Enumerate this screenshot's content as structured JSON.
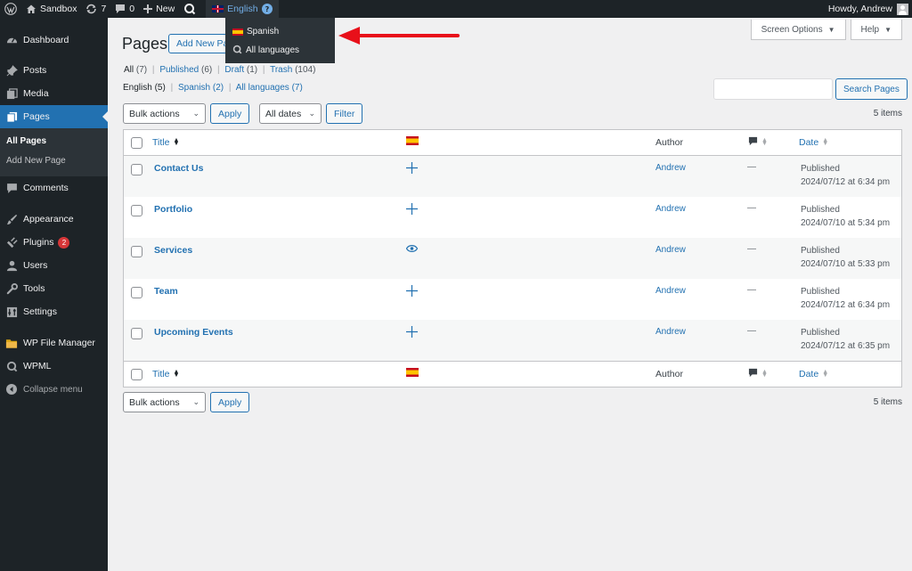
{
  "admin_bar": {
    "site_name": "Sandbox",
    "updates_count": "7",
    "comments_count": "0",
    "new_label": "New",
    "current_language": "English",
    "greeting": "Howdy, Andrew"
  },
  "language_menu": {
    "items": [
      {
        "label": "Spanish",
        "icon": "spain-flag-icon"
      },
      {
        "label": "All languages",
        "icon": "wpml-icon"
      }
    ]
  },
  "sidebar": {
    "items": [
      {
        "label": "Dashboard",
        "icon": "dashboard-icon"
      },
      {
        "label": "Posts",
        "icon": "pin-icon"
      },
      {
        "label": "Media",
        "icon": "media-icon"
      },
      {
        "label": "Pages",
        "icon": "pages-icon",
        "current": true
      },
      {
        "label": "Comments",
        "icon": "comment-icon"
      },
      {
        "label": "Appearance",
        "icon": "paintbrush-icon"
      },
      {
        "label": "Plugins",
        "icon": "plugin-icon",
        "badge": "2"
      },
      {
        "label": "Users",
        "icon": "users-icon"
      },
      {
        "label": "Tools",
        "icon": "wrench-icon"
      },
      {
        "label": "Settings",
        "icon": "settings-icon"
      },
      {
        "label": "WP File Manager",
        "icon": "folder-icon"
      },
      {
        "label": "WPML",
        "icon": "wpml-icon"
      }
    ],
    "submenu": [
      "All Pages",
      "Add New Page"
    ],
    "collapse_label": "Collapse menu"
  },
  "header": {
    "title": "Pages",
    "add_new": "Add New Page",
    "screen_options": "Screen Options",
    "help": "Help"
  },
  "status_filters": {
    "all": "All",
    "all_count": "(7)",
    "published": "Published",
    "published_count": "(6)",
    "draft": "Draft",
    "draft_count": "(1)",
    "trash": "Trash",
    "trash_count": "(104)"
  },
  "lang_filters": {
    "english": "English (5)",
    "spanish": "Spanish (2)",
    "all": "All languages (7)"
  },
  "search": {
    "button": "Search Pages",
    "value": ""
  },
  "toolbar": {
    "bulk_actions": "Bulk actions",
    "apply": "Apply",
    "all_dates": "All dates",
    "filter": "Filter",
    "items_count": "5 items"
  },
  "table": {
    "headers": {
      "title": "Title",
      "author": "Author",
      "date": "Date"
    },
    "rows": [
      {
        "title": "Contact Us",
        "lang_action": "plus-icon",
        "author": "Andrew",
        "comments": "—",
        "status": "Published",
        "date": "2024/07/12 at 6:34 pm"
      },
      {
        "title": "Portfolio",
        "lang_action": "plus-icon",
        "author": "Andrew",
        "comments": "—",
        "status": "Published",
        "date": "2024/07/10 at 5:34 pm"
      },
      {
        "title": "Services",
        "lang_action": "eye-icon",
        "author": "Andrew",
        "comments": "—",
        "status": "Published",
        "date": "2024/07/10 at 5:33 pm"
      },
      {
        "title": "Team",
        "lang_action": "plus-icon",
        "author": "Andrew",
        "comments": "—",
        "status": "Published",
        "date": "2024/07/12 at 6:34 pm"
      },
      {
        "title": "Upcoming Events",
        "lang_action": "plus-icon",
        "author": "Andrew",
        "comments": "—",
        "status": "Published",
        "date": "2024/07/12 at 6:35 pm"
      }
    ]
  },
  "colors": {
    "admin_bar_bg": "#1d2327",
    "accent": "#2271b1",
    "annotation_arrow": "#e8101a"
  }
}
